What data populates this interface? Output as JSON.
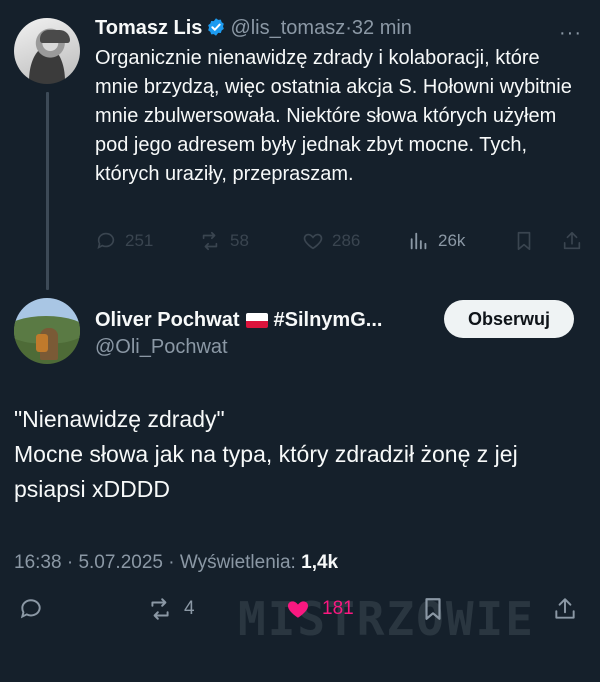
{
  "parent_tweet": {
    "author_name": "Tomasz Lis",
    "author_handle": "@lis_tomasz",
    "separator": "·",
    "time_ago": "32 min",
    "more": "···",
    "text": "Organicznie nienawidzę zdrady i kolaboracji, które mnie brzydzą, więc ostatnia akcja S. Hołowni wybitnie mnie zbulwersowała. Niektóre słowa których użyłem pod jego adresem były jednak zbyt mocne. Tych, których uraziły, przepraszam.",
    "stats": {
      "replies": "251",
      "reposts": "58",
      "likes": "286",
      "views": "26k"
    }
  },
  "reply_tweet": {
    "author_name": "Oliver Pochwat",
    "author_name_suffix": "#SilnymG...",
    "author_handle": "@Oli_Pochwat",
    "follow_label": "Obserwuj",
    "text_line1": "\"Nienawidzę zdrady\"",
    "text_line2": "Mocne słowa jak na typa, który zdradził żonę z jej psiapsi xDDDD",
    "time": "16:38",
    "dot": "·",
    "date": "5.07.2025",
    "views_label": "Wyświetlenia:",
    "views_count": "1,4k",
    "stats": {
      "reposts": "4",
      "likes": "181"
    }
  },
  "watermark": "MISTRZOWIE",
  "colors": {
    "background": "#15202b",
    "muted": "#8b98a5",
    "like": "#f91880",
    "verified": "#1d9bf0",
    "button_bg": "#eff3f4"
  }
}
